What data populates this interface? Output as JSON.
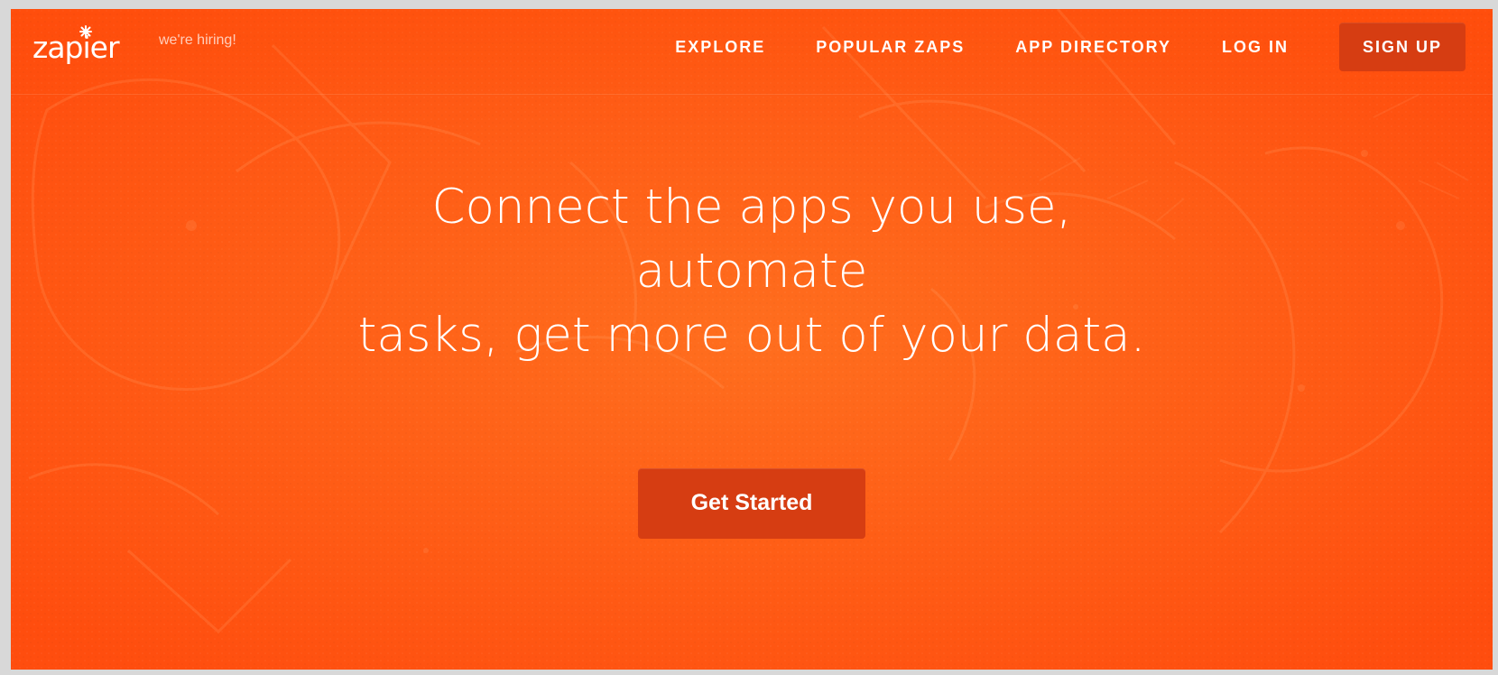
{
  "header": {
    "brand": "zapier",
    "hiring": "we're hiring!",
    "nav": [
      "EXPLORE",
      "POPULAR ZAPS",
      "APP DIRECTORY",
      "LOG IN"
    ],
    "signup": "SIGN UP"
  },
  "hero": {
    "headline_line1": "Connect the apps you use, automate",
    "headline_line2": "tasks, get more out of your data.",
    "cta": "Get Started"
  },
  "colors": {
    "accent": "#ff5a14",
    "button": "#d63d12"
  }
}
